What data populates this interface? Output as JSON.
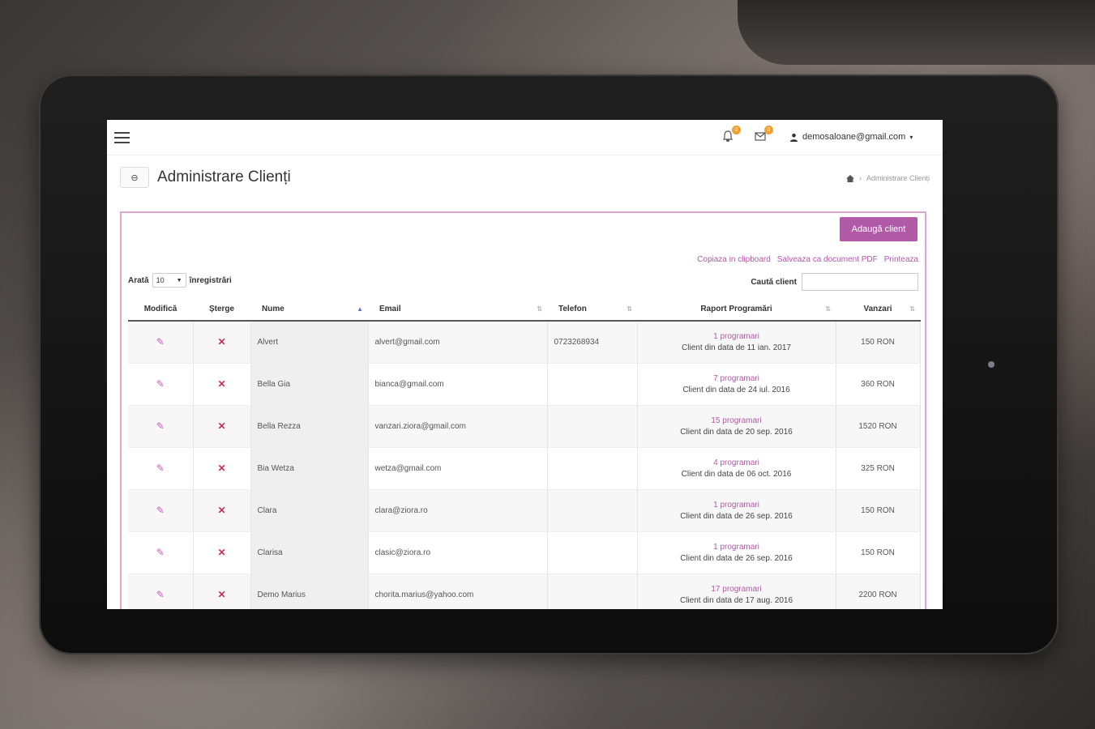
{
  "header": {
    "bell_badge": "0",
    "mail_badge": "0",
    "user_email": "demosaloane@gmail.com"
  },
  "page": {
    "back_label": "⊖",
    "title": "Administrare Clienți",
    "breadcrumb_current": "Administrare Clienți"
  },
  "toolbar": {
    "add_label": "Adaugă client",
    "copy_label": "Copiaza in clipboard",
    "pdf_label": "Salveaza ca document PDF",
    "print_label": "Printeaza",
    "show_prefix": "Arată",
    "show_value": "10",
    "show_suffix": "înregistrări",
    "search_label": "Caută client"
  },
  "table": {
    "headers": [
      "Modifică",
      "Șterge",
      "Nume",
      "Email",
      "Telefon",
      "Raport Programări",
      "Vanzari"
    ],
    "rows": [
      {
        "name": "Alvert",
        "email": "alvert@gmail.com",
        "phone": "0723268934",
        "prog": "1 programari",
        "since": "Client din data de 11 ian. 2017",
        "sales": "150 RON"
      },
      {
        "name": "Bella Gia",
        "email": "bianca@gmail.com",
        "phone": "",
        "prog": "7 programari",
        "since": "Client din data de 24 iul. 2016",
        "sales": "360 RON"
      },
      {
        "name": "Bella Rezza",
        "email": "vanzari.ziora@gmail.com",
        "phone": "",
        "prog": "15 programari",
        "since": "Client din data de 20 sep. 2016",
        "sales": "1520 RON"
      },
      {
        "name": "Bia Wetza",
        "email": "wetza@gmail.com",
        "phone": "",
        "prog": "4 programari",
        "since": "Client din data de 06 oct. 2016",
        "sales": "325 RON"
      },
      {
        "name": "Clara",
        "email": "clara@ziora.ro",
        "phone": "",
        "prog": "1 programari",
        "since": "Client din data de 26 sep. 2016",
        "sales": "150 RON"
      },
      {
        "name": "Clarisa",
        "email": "clasic@ziora.ro",
        "phone": "",
        "prog": "1 programari",
        "since": "Client din data de 26 sep. 2016",
        "sales": "150 RON"
      },
      {
        "name": "Demo Marius",
        "email": "chorita.marius@yahoo.com",
        "phone": "",
        "prog": "17 programari",
        "since": "Client din data de 17 aug. 2016",
        "sales": "2200 RON"
      }
    ]
  }
}
